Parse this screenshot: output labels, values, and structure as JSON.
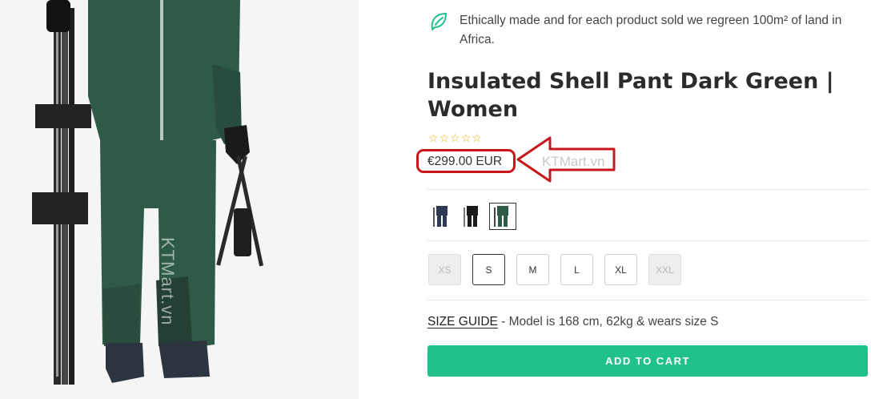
{
  "product": {
    "eco_note": "Ethically made and for each product sold we regreen 100m² of land in Africa.",
    "title": "Insulated Shell Pant Dark Green | Women",
    "rating_stars": 5,
    "rating_value": 0,
    "price": "€299.00 EUR",
    "watermark": "KTMart.vn",
    "photo_watermark": "KTMart.vn"
  },
  "colors": {
    "accent": "#21c28a",
    "highlight_red": "#c9161c",
    "jacket_green": "#2f5a48",
    "star": "#e3b308"
  },
  "swatches": [
    {
      "name": "navy",
      "color": "#2d3a56",
      "selected": false
    },
    {
      "name": "black",
      "color": "#1a1a1a",
      "selected": false
    },
    {
      "name": "dark-green",
      "color": "#2f5a48",
      "selected": true
    }
  ],
  "sizes": [
    {
      "label": "XS",
      "state": "disabled"
    },
    {
      "label": "S",
      "state": "selected"
    },
    {
      "label": "M",
      "state": "available"
    },
    {
      "label": "L",
      "state": "available"
    },
    {
      "label": "XL",
      "state": "available"
    },
    {
      "label": "XXL",
      "state": "disabled"
    }
  ],
  "size_guide": {
    "link": "SIZE GUIDE",
    "text": " - Model is 168 cm, 62kg & wears size S"
  },
  "cart": {
    "label": "ADD TO CART"
  },
  "icons": {
    "leaf": "leaf-icon",
    "star": "star-outline-icon"
  }
}
